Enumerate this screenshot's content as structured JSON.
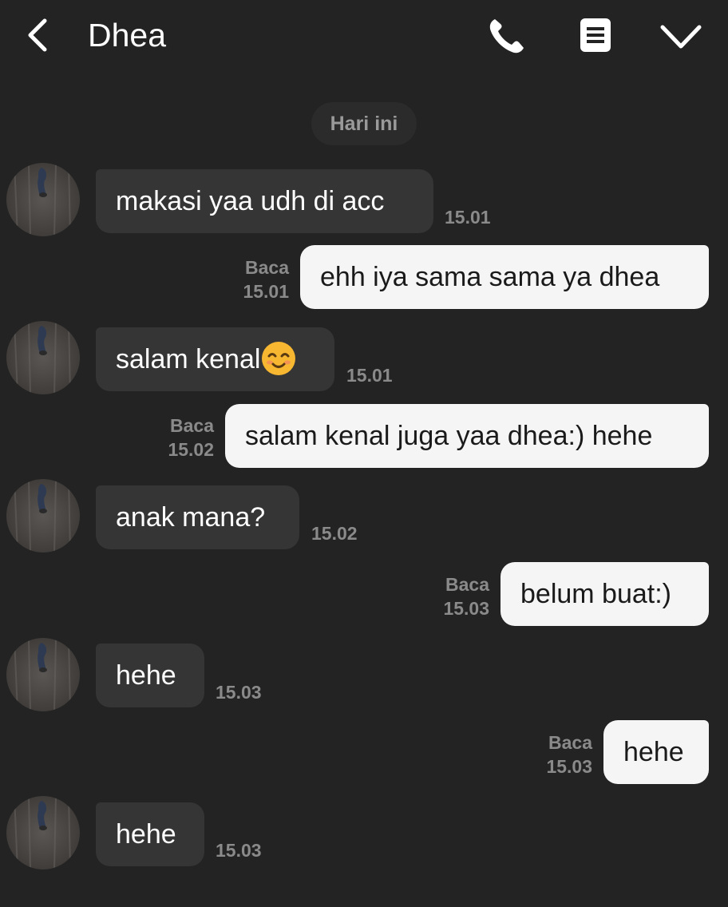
{
  "header": {
    "contact_name": "Dhea",
    "icons": [
      "back-icon",
      "phone-icon",
      "menu-icon",
      "chevron-down-icon"
    ]
  },
  "date_separator": "Hari ini",
  "colors": {
    "background": "#232323",
    "incoming_bubble": "#353535",
    "outgoing_bubble": "#f5f5f5",
    "meta_text": "#8a8a8a"
  },
  "messages": [
    {
      "direction": "in",
      "text": "makasi yaa udh di acc",
      "time": "15.01"
    },
    {
      "direction": "out",
      "text": "ehh iya sama sama ya dhea",
      "status": "Baca",
      "time": "15.01"
    },
    {
      "direction": "in",
      "text": "salam kenal",
      "emoji": "smiling-face-emoji",
      "time": "15.01"
    },
    {
      "direction": "out",
      "text": "salam kenal juga yaa dhea:) hehe",
      "status": "Baca",
      "time": "15.02"
    },
    {
      "direction": "in",
      "text": "anak mana?",
      "time": "15.02"
    },
    {
      "direction": "out",
      "text": "belum buat:)",
      "status": "Baca",
      "time": "15.03"
    },
    {
      "direction": "in",
      "text": "hehe",
      "time": "15.03"
    },
    {
      "direction": "out",
      "text": "hehe",
      "status": "Baca",
      "time": "15.03"
    },
    {
      "direction": "in",
      "text": "hehe",
      "time": "15.03"
    }
  ]
}
